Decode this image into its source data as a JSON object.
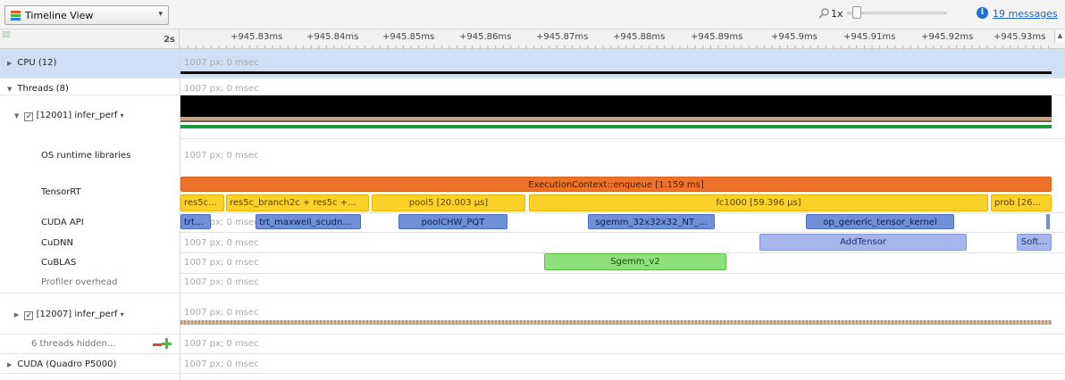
{
  "toolbar": {
    "view_select": "Timeline View",
    "zoom_label": "1x",
    "messages_link": "19 messages",
    "zoom_level": 0.05
  },
  "ruler": {
    "origin_label": "2s",
    "ticks": [
      "+945.83ms",
      "+945.84ms",
      "+945.85ms",
      "+945.86ms",
      "+945.87ms",
      "+945.88ms",
      "+945.89ms",
      "+945.9ms",
      "+945.91ms",
      "+945.92ms",
      "+945.93ms"
    ]
  },
  "rows": {
    "cpu": "CPU (12)",
    "threads": "Threads (8)",
    "thread1": "[12001] infer_perf",
    "os_runtime": "OS runtime libraries",
    "tensorrt": "TensorRT",
    "cuda_api": "CUDA API",
    "cudnn": "CuDNN",
    "cublas": "CuBLAS",
    "profiler": "Profiler overhead",
    "thread2": "[12007] infer_perf",
    "hidden": "6 threads hidden...",
    "cuda_dev": "CUDA (Quadro P5000)"
  },
  "placeholder": "1007 px; 0 msec",
  "tensorrt_bars": {
    "exec": "ExecutionContext::enqueue [1.159 ms]",
    "y1": "res5c...",
    "y2": "res5c_branch2c + res5c +...",
    "y3": "pool5 [20.003 µs]",
    "y4": "fc1000 [59.396 µs]",
    "y5": "prob [26..."
  },
  "cuda_api_bars": {
    "b1": "trt_...",
    "b2": "trt_maxwell_scudn...",
    "b3": "poolCHW_PQT",
    "b4": "sgemm_32x32x32_NT_...",
    "b5": "op_generic_tensor_kernel"
  },
  "cudnn_bars": {
    "b1": "AddTensor",
    "b2": "Soft..."
  },
  "cublas_bars": {
    "b1": "Sgemm_v2"
  },
  "colors": {
    "execution": "#ee7328",
    "tensorrt": "#fbd12a",
    "cuda_api": "#6f8fd8",
    "cudnn": "#a6b6ec",
    "cublas": "#8de07c",
    "cpu_row_bg": "#cfe0f6"
  }
}
